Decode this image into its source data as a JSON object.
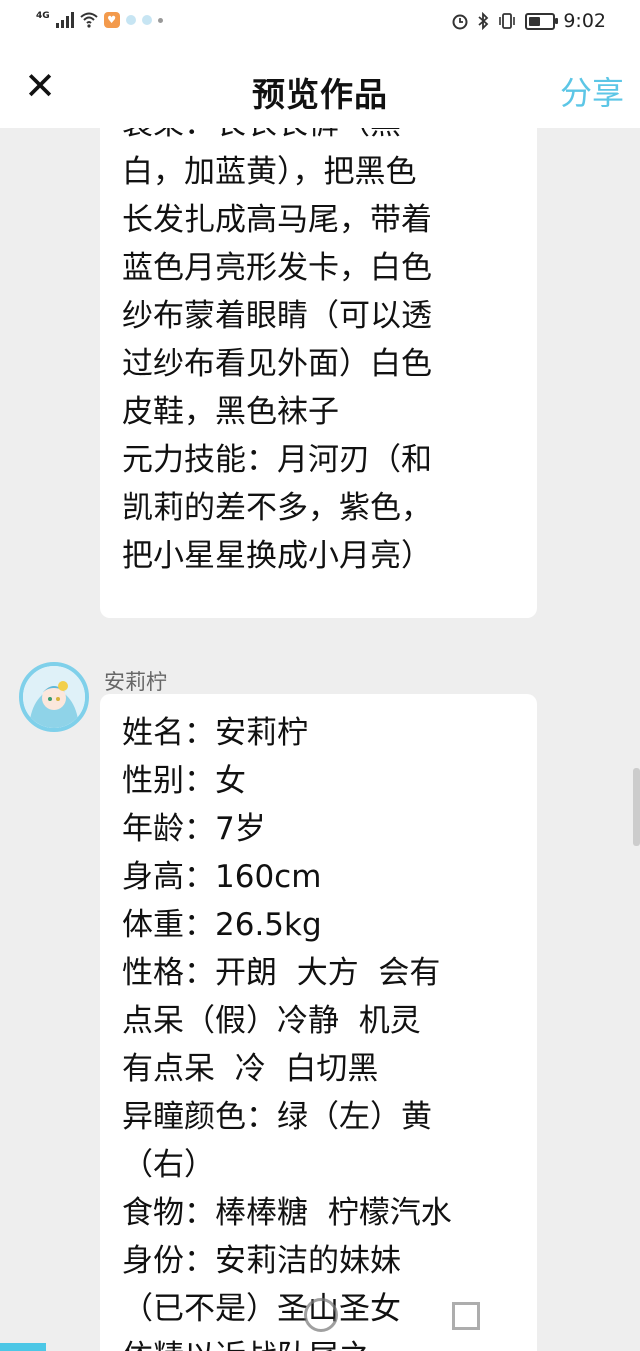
{
  "status_bar": {
    "network": "4G",
    "time": "9:02",
    "icons": [
      "signal-icon",
      "wifi-icon",
      "app-notification-icon",
      "alarm-icon",
      "bluetooth-icon",
      "vibrate-icon",
      "battery-icon"
    ],
    "battery_level": 0.4
  },
  "header": {
    "title": "预览作品",
    "share_label": "分享",
    "close_icon": "close-icon"
  },
  "messages": [
    {
      "lines": [
        "装束：长衣长裤（黑",
        "白，加蓝黄），把黑色",
        "长发扎成高马尾，带着",
        "蓝色月亮形发卡，白色",
        "纱布蒙着眼睛（可以透",
        "过纱布看见外面）白色",
        "皮鞋，黑色袜子",
        "元力技能：月河刃（和",
        "凯莉的差不多，紫色，",
        "把小星星换成小月亮）"
      ]
    },
    {
      "sender": "安莉柠",
      "lines": [
        "姓名：安莉柠",
        "性别：女",
        "年龄：7岁",
        "身高：160cm",
        "体重：26.5kg",
        "性格：开朗  大方  会有",
        "点呆（假）冷静  机灵",
        "有点呆  冷  白切黑",
        "异瞳颜色：绿（左）黄",
        "（右）",
        "食物：棒棒糖  柠檬汽水",
        "身份：安莉洁的妹妹",
        "（已不是）圣山圣女",
        "依精以近战队尾之"
      ]
    }
  ],
  "colors": {
    "accent": "#5cc6e6",
    "background": "#eeeeee",
    "bubble": "#ffffff"
  }
}
